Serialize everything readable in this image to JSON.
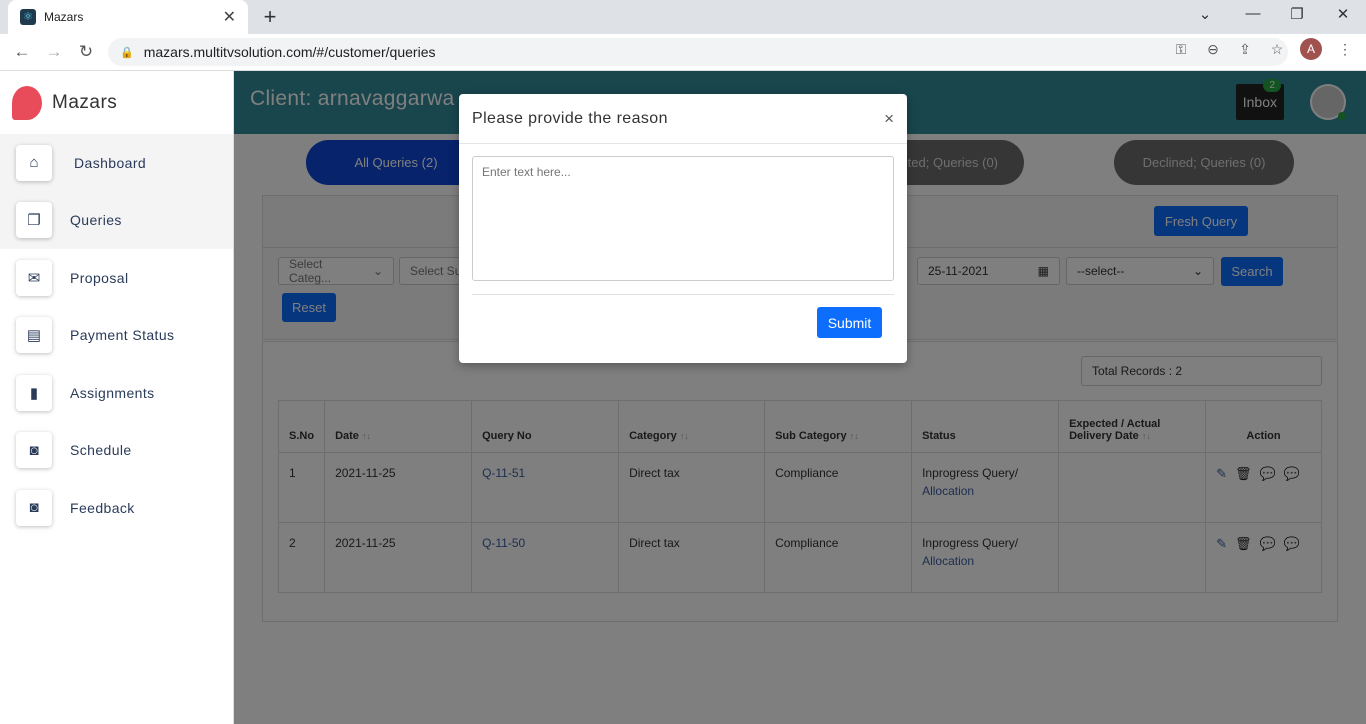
{
  "browser": {
    "tab_title": "Mazars",
    "url": "mazars.multitvsolution.com/#/customer/queries",
    "profile_initial": "A"
  },
  "sidebar": {
    "brand": "Mazars",
    "items": [
      {
        "label": "Dashboard",
        "icon": "home-icon"
      },
      {
        "label": "Queries",
        "icon": "copy-icon"
      },
      {
        "label": "Proposal",
        "icon": "envelope-icon"
      },
      {
        "label": "Payment Status",
        "icon": "document-icon"
      },
      {
        "label": "Assignments",
        "icon": "file-icon"
      },
      {
        "label": "Schedule",
        "icon": "rss-icon"
      },
      {
        "label": "Feedback",
        "icon": "rss-icon"
      }
    ]
  },
  "header": {
    "client": "Client: arnavaggarwa",
    "inbox": "Inbox",
    "inbox_count": "2"
  },
  "tabs": {
    "all": "All Queries (2)",
    "completed": "eted; Queries (0)",
    "declined": "Declined; Queries (0)"
  },
  "filters": {
    "fresh_query": "Fresh Query",
    "category_placeholder": "Select Categ...",
    "subcategory_placeholder": "Select Su",
    "date_value": "25-11-2021",
    "status_select": "--select--",
    "search": "Search",
    "reset": "Reset"
  },
  "table": {
    "total_records": "Total Records : 2",
    "headers": [
      "S.No",
      "Date",
      "Query No",
      "Category",
      "Sub Category",
      "Status",
      "Expected / Actual",
      "Delivery Date",
      "Action"
    ],
    "rows": [
      {
        "sno": "1",
        "date": "2021-11-25",
        "query_no": "Q-11-51",
        "category": "Direct tax",
        "sub_category": "Compliance",
        "status": "Inprogress Query/",
        "status_sub": "Allocation"
      },
      {
        "sno": "2",
        "date": "2021-11-25",
        "query_no": "Q-11-50",
        "category": "Direct tax",
        "sub_category": "Compliance",
        "status": "Inprogress Query/",
        "status_sub": "Allocation"
      }
    ]
  },
  "modal": {
    "title": "Please provide the reason",
    "close": "×",
    "placeholder": "Enter text here...",
    "submit": "Submit"
  },
  "colors": {
    "header_bg": "#338a9a",
    "primary": "#0d6efd",
    "pill_active": "#0d47d6",
    "pill_inactive": "#6c6c6c"
  }
}
